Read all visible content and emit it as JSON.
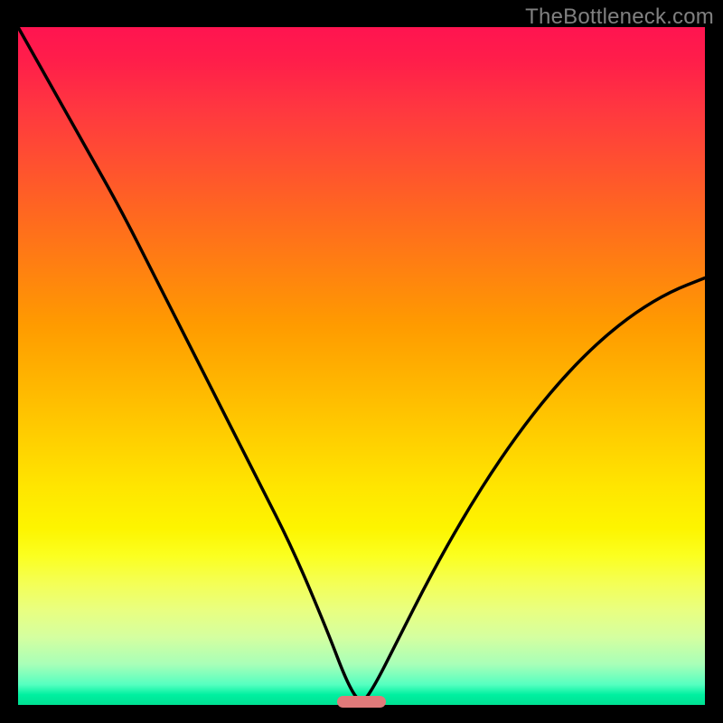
{
  "watermark": "TheBottleneck.com",
  "chart_data": {
    "type": "line",
    "title": "",
    "xlabel": "",
    "ylabel": "",
    "xlim": [
      0,
      100
    ],
    "ylim": [
      0,
      100
    ],
    "grid": false,
    "legend": false,
    "background_gradient": {
      "description": "Vertical rainbow gradient: red-pink at top through orange, yellow to green at bottom",
      "stops": [
        {
          "pos": 0,
          "color": "#ff1450"
        },
        {
          "pos": 20,
          "color": "#ff5030"
        },
        {
          "pos": 44,
          "color": "#ff9b00"
        },
        {
          "pos": 68,
          "color": "#ffe600"
        },
        {
          "pos": 86,
          "color": "#e9ff80"
        },
        {
          "pos": 100,
          "color": "#00e092"
        }
      ]
    },
    "series": [
      {
        "name": "bottleneck-curve",
        "description": "V-shaped black curve with two arms; steep left arm from top-left corner descending to minimum around x≈48-52, right arm rising with decreasing slope toward upper right",
        "color": "#000000",
        "x": [
          0,
          5,
          10,
          15,
          20,
          25,
          30,
          35,
          40,
          45,
          48,
          50,
          52,
          55,
          60,
          65,
          70,
          75,
          80,
          85,
          90,
          95,
          100
        ],
        "values": [
          100,
          91,
          82,
          73,
          63,
          53,
          43,
          33,
          23,
          11,
          3,
          0,
          3,
          9,
          19,
          28,
          36,
          43,
          49,
          54,
          58,
          61,
          63
        ]
      }
    ],
    "annotations": [
      {
        "type": "marker",
        "shape": "rounded-bar",
        "color": "#e07a7a",
        "x_center": 50,
        "y": 0.5,
        "width_pct": 7,
        "height_pct": 1.7,
        "description": "Small salmon-pink rounded horizontal marker at valley minimum near baseline"
      }
    ]
  }
}
